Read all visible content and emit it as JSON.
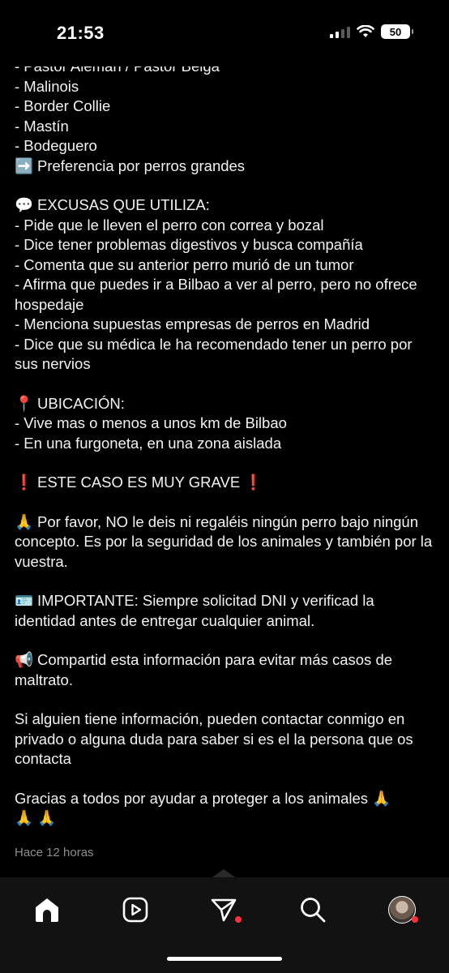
{
  "status": {
    "time": "21:53",
    "battery": "50"
  },
  "post": {
    "lines": [
      "- Pastor Alemán / Pastor Belga",
      "- Malinois",
      "- Border Collie",
      "- Mastín",
      "- Bodeguero",
      "Preferencia por perros grandes",
      "EXCUSAS QUE UTILIZA:",
      "- Pide que le lleven el perro con correa y bozal",
      "- Dice tener problemas digestivos y busca compañía",
      "- Comenta que su anterior perro murió de un tumor",
      "- Afirma que puedes ir a Bilbao a ver al perro, pero no ofrece hospedaje",
      "- Menciona supuestas empresas de perros en Madrid",
      "- Dice que su médica le ha recomendado tener un perro por sus nervios",
      "UBICACIÓN:",
      "- Vive mas o menos a unos  km de Bilbao",
      "- En una furgoneta, en una zona aislada",
      "ESTE CASO ES MUY GRAVE",
      "Por favor, NO le deis ni regaléis ningún perro bajo ningún concepto. Es por la seguridad de los animales y también por la vuestra.",
      "IMPORTANTE: Siempre solicitad DNI y verificad la identidad antes de entregar cualquier animal.",
      "Compartid esta información para evitar más casos de maltrato.",
      "Si alguien tiene información, pueden contactar conmigo en privado o alguna duda para saber si es el la persona que os contacta",
      "Gracias a todos por ayudar a proteger a los animales"
    ],
    "emojis": {
      "arrow": "➡️",
      "speech": "💬",
      "pin": "📍",
      "exclamation": "❗",
      "pray": "🙏",
      "id_card": "🪪",
      "megaphone": "📢"
    },
    "time_ago": "Hace 12 horas"
  },
  "nav": {
    "items": [
      "home-icon",
      "reels-icon",
      "direct-icon",
      "search-icon",
      "profile-avatar"
    ],
    "notification_color": "#ff3040"
  }
}
